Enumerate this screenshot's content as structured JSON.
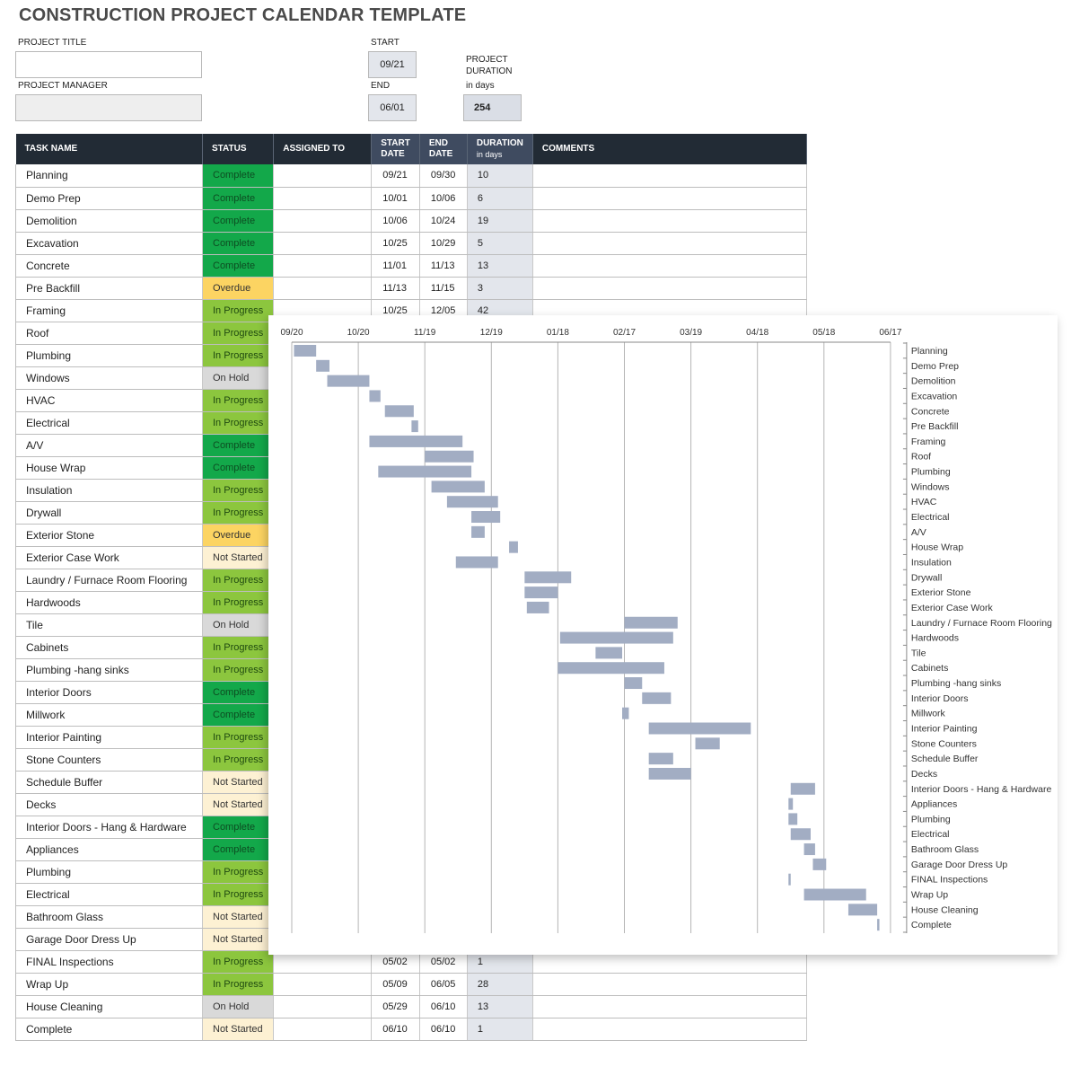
{
  "title": "CONSTRUCTION PROJECT CALENDAR TEMPLATE",
  "project": {
    "title_label": "PROJECT TITLE",
    "title_value": "",
    "manager_label": "PROJECT MANAGER",
    "manager_value": "",
    "start_label": "START",
    "start_value": "09/21",
    "end_label": "END",
    "end_value": "06/01",
    "duration_label_line1": "PROJECT",
    "duration_label_line2": "DURATION",
    "duration_label_line3": "in days",
    "duration_value": "254"
  },
  "status_colors": {
    "Complete": {
      "bg": "#13a84a",
      "fg": "#0d4d22"
    },
    "In Progress": {
      "bg": "#8cc63e",
      "fg": "#1f4a10"
    },
    "Overdue": {
      "bg": "#fcd462",
      "fg": "#333333"
    },
    "On Hold": {
      "bg": "#d9d9d9",
      "fg": "#333333"
    },
    "Not Started": {
      "bg": "#fdf1d3",
      "fg": "#333333"
    }
  },
  "table": {
    "headers": {
      "task": "TASK NAME",
      "status": "STATUS",
      "assigned": "ASSIGNED TO",
      "start_line1": "START",
      "start_line2": "DATE",
      "end_line1": "END",
      "end_line2": "DATE",
      "duration_line1": "DURATION",
      "duration_line2": "in days",
      "comments": "COMMENTS"
    },
    "rows": [
      {
        "task": "Planning",
        "status": "Complete",
        "assigned": "",
        "start": "09/21",
        "end": "09/30",
        "duration": "10",
        "comments": ""
      },
      {
        "task": "Demo Prep",
        "status": "Complete",
        "assigned": "",
        "start": "10/01",
        "end": "10/06",
        "duration": "6",
        "comments": ""
      },
      {
        "task": "Demolition",
        "status": "Complete",
        "assigned": "",
        "start": "10/06",
        "end": "10/24",
        "duration": "19",
        "comments": ""
      },
      {
        "task": "Excavation",
        "status": "Complete",
        "assigned": "",
        "start": "10/25",
        "end": "10/29",
        "duration": "5",
        "comments": ""
      },
      {
        "task": "Concrete",
        "status": "Complete",
        "assigned": "",
        "start": "11/01",
        "end": "11/13",
        "duration": "13",
        "comments": ""
      },
      {
        "task": "Pre Backfill",
        "status": "Overdue",
        "assigned": "",
        "start": "11/13",
        "end": "11/15",
        "duration": "3",
        "comments": ""
      },
      {
        "task": "Framing",
        "status": "In Progress",
        "assigned": "",
        "start": "10/25",
        "end": "12/05",
        "duration": "42",
        "comments": ""
      },
      {
        "task": "Roof",
        "status": "In Progress",
        "assigned": "",
        "start": "",
        "end": "",
        "duration": "",
        "comments": ""
      },
      {
        "task": "Plumbing",
        "status": "In Progress",
        "assigned": "",
        "start": "",
        "end": "",
        "duration": "",
        "comments": ""
      },
      {
        "task": "Windows",
        "status": "On Hold",
        "assigned": "",
        "start": "",
        "end": "",
        "duration": "",
        "comments": ""
      },
      {
        "task": "HVAC",
        "status": "In Progress",
        "assigned": "",
        "start": "",
        "end": "",
        "duration": "",
        "comments": ""
      },
      {
        "task": "Electrical",
        "status": "In Progress",
        "assigned": "",
        "start": "",
        "end": "",
        "duration": "",
        "comments": ""
      },
      {
        "task": "A/V",
        "status": "Complete",
        "assigned": "",
        "start": "",
        "end": "",
        "duration": "",
        "comments": ""
      },
      {
        "task": "House Wrap",
        "status": "Complete",
        "assigned": "",
        "start": "",
        "end": "",
        "duration": "",
        "comments": ""
      },
      {
        "task": "Insulation",
        "status": "In Progress",
        "assigned": "",
        "start": "",
        "end": "",
        "duration": "",
        "comments": ""
      },
      {
        "task": "Drywall",
        "status": "In Progress",
        "assigned": "",
        "start": "",
        "end": "",
        "duration": "",
        "comments": ""
      },
      {
        "task": "Exterior Stone",
        "status": "Overdue",
        "assigned": "",
        "start": "",
        "end": "",
        "duration": "",
        "comments": ""
      },
      {
        "task": "Exterior Case Work",
        "status": "Not Started",
        "assigned": "",
        "start": "",
        "end": "",
        "duration": "",
        "comments": ""
      },
      {
        "task": "Laundry / Furnace Room Flooring",
        "status": "In Progress",
        "assigned": "",
        "start": "",
        "end": "",
        "duration": "",
        "comments": ""
      },
      {
        "task": "Hardwoods",
        "status": "In Progress",
        "assigned": "",
        "start": "",
        "end": "",
        "duration": "",
        "comments": ""
      },
      {
        "task": "Tile",
        "status": "On Hold",
        "assigned": "",
        "start": "",
        "end": "",
        "duration": "",
        "comments": ""
      },
      {
        "task": "Cabinets",
        "status": "In Progress",
        "assigned": "",
        "start": "",
        "end": "",
        "duration": "",
        "comments": ""
      },
      {
        "task": "Plumbing -hang sinks",
        "status": "In Progress",
        "assigned": "",
        "start": "",
        "end": "",
        "duration": "",
        "comments": ""
      },
      {
        "task": "Interior Doors",
        "status": "Complete",
        "assigned": "",
        "start": "",
        "end": "",
        "duration": "",
        "comments": ""
      },
      {
        "task": "Millwork",
        "status": "Complete",
        "assigned": "",
        "start": "",
        "end": "",
        "duration": "",
        "comments": ""
      },
      {
        "task": "Interior Painting",
        "status": "In Progress",
        "assigned": "",
        "start": "",
        "end": "",
        "duration": "",
        "comments": ""
      },
      {
        "task": "Stone Counters",
        "status": "In Progress",
        "assigned": "",
        "start": "",
        "end": "",
        "duration": "",
        "comments": ""
      },
      {
        "task": "Schedule Buffer",
        "status": "Not Started",
        "assigned": "",
        "start": "",
        "end": "",
        "duration": "",
        "comments": ""
      },
      {
        "task": "Decks",
        "status": "Not Started",
        "assigned": "",
        "start": "",
        "end": "",
        "duration": "",
        "comments": ""
      },
      {
        "task": "Interior Doors - Hang & Hardware",
        "status": "Complete",
        "assigned": "",
        "start": "",
        "end": "",
        "duration": "",
        "comments": ""
      },
      {
        "task": "Appliances",
        "status": "Complete",
        "assigned": "",
        "start": "",
        "end": "",
        "duration": "",
        "comments": ""
      },
      {
        "task": "Plumbing",
        "status": "In Progress",
        "assigned": "",
        "start": "",
        "end": "",
        "duration": "",
        "comments": ""
      },
      {
        "task": "Electrical",
        "status": "In Progress",
        "assigned": "",
        "start": "",
        "end": "",
        "duration": "",
        "comments": ""
      },
      {
        "task": "Bathroom Glass",
        "status": "Not Started",
        "assigned": "",
        "start": "",
        "end": "",
        "duration": "",
        "comments": ""
      },
      {
        "task": "Garage Door Dress Up",
        "status": "Not Started",
        "assigned": "",
        "start": "",
        "end": "",
        "duration": "",
        "comments": ""
      },
      {
        "task": "FINAL Inspections",
        "status": "In Progress",
        "assigned": "",
        "start": "05/02",
        "end": "05/02",
        "duration": "1",
        "comments": ""
      },
      {
        "task": "Wrap Up",
        "status": "In Progress",
        "assigned": "",
        "start": "05/09",
        "end": "06/05",
        "duration": "28",
        "comments": ""
      },
      {
        "task": "House Cleaning",
        "status": "On Hold",
        "assigned": "",
        "start": "05/29",
        "end": "06/10",
        "duration": "13",
        "comments": ""
      },
      {
        "task": "Complete",
        "status": "Not Started",
        "assigned": "",
        "start": "06/10",
        "end": "06/10",
        "duration": "1",
        "comments": ""
      }
    ]
  },
  "chart_data": {
    "type": "bar",
    "subtype": "gantt",
    "title": "",
    "x_axis_origin": "09/20",
    "x_units": "days since 09/20",
    "xlim": [
      0,
      270
    ],
    "x_tick_values": [
      0,
      30,
      60,
      90,
      120,
      150,
      180,
      210,
      240,
      270
    ],
    "x_tick_labels": [
      "09/20",
      "10/20",
      "11/19",
      "12/19",
      "01/18",
      "02/17",
      "03/19",
      "04/18",
      "05/18",
      "06/17"
    ],
    "grid": true,
    "bar_color": "#a2adc3",
    "categories": [
      "Planning",
      "Demo Prep",
      "Demolition",
      "Excavation",
      "Concrete",
      "Pre Backfill",
      "Framing",
      "Roof",
      "Plumbing",
      "Windows",
      "HVAC",
      "Electrical",
      "A/V",
      "House Wrap",
      "Insulation",
      "Drywall",
      "Exterior Stone",
      "Exterior Case Work",
      "Laundry / Furnace Room Flooring",
      "Hardwoods",
      "Tile",
      "Cabinets",
      "Plumbing -hang sinks",
      "Interior Doors",
      "Millwork",
      "Interior Painting",
      "Stone Counters",
      "Schedule Buffer",
      "Decks",
      "Interior Doors - Hang & Hardware",
      "Appliances",
      "Plumbing",
      "Electrical",
      "Bathroom Glass",
      "Garage Door Dress Up",
      "FINAL Inspections",
      "Wrap Up",
      "House Cleaning",
      "Complete"
    ],
    "start_day": [
      1,
      11,
      16,
      35,
      42,
      54,
      35,
      60,
      39,
      63,
      70,
      81,
      81,
      98,
      74,
      105,
      105,
      106,
      150,
      121,
      137,
      120,
      150,
      158,
      149,
      161,
      182,
      161,
      161,
      225,
      224,
      224,
      225,
      231,
      235,
      224,
      231,
      251,
      264
    ],
    "duration_day": [
      10,
      6,
      19,
      5,
      13,
      3,
      42,
      22,
      42,
      24,
      23,
      13,
      6,
      4,
      19,
      21,
      15,
      10,
      24,
      51,
      12,
      48,
      8,
      13,
      3,
      46,
      11,
      11,
      19,
      11,
      2,
      4,
      9,
      5,
      6,
      1,
      28,
      13,
      1
    ]
  }
}
